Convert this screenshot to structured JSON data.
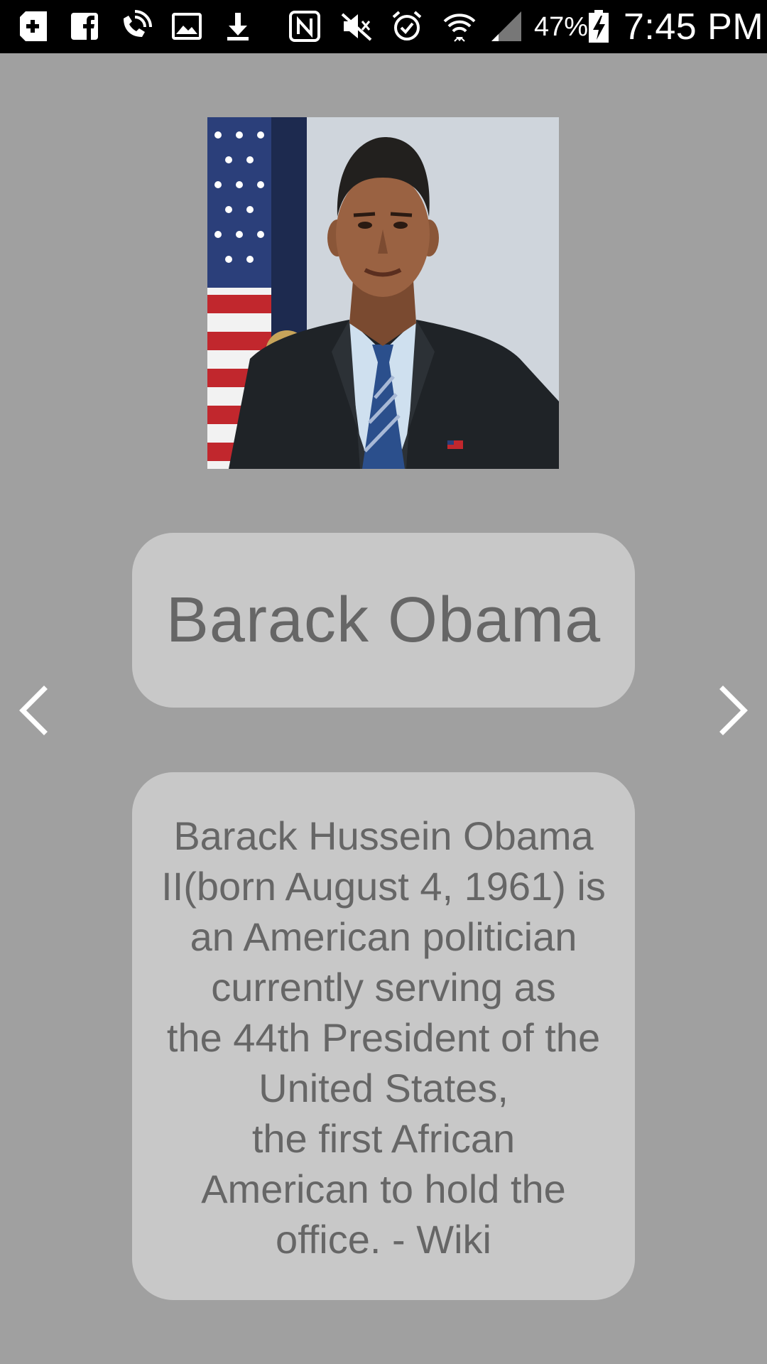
{
  "status_bar": {
    "battery_percent": "47%",
    "time": "7:45 PM",
    "icons": [
      "add-box-icon",
      "facebook-icon",
      "wifi-call-icon",
      "image-icon",
      "download-icon",
      "nfc-icon",
      "mute-icon",
      "alarm-icon",
      "wifi-icon",
      "signal-icon",
      "battery-charging-icon"
    ]
  },
  "portrait": {
    "icon": "portrait-photo"
  },
  "profile": {
    "name": "Barack Obama",
    "bio_lines": [
      "Barack Hussein Obama",
      "II(born August 4, 1961) is",
      "an American politician",
      "currently serving as",
      "the 44th President of the",
      "United States,",
      "the first African",
      "American to hold the",
      "office. - Wiki"
    ]
  },
  "navigation": {
    "prev_icon": "chevron-left-icon",
    "next_icon": "chevron-right-icon"
  },
  "colors": {
    "background": "#a0a0a0",
    "card": "#c8c8c8",
    "text": "#666666",
    "status_bar": "#000000"
  }
}
